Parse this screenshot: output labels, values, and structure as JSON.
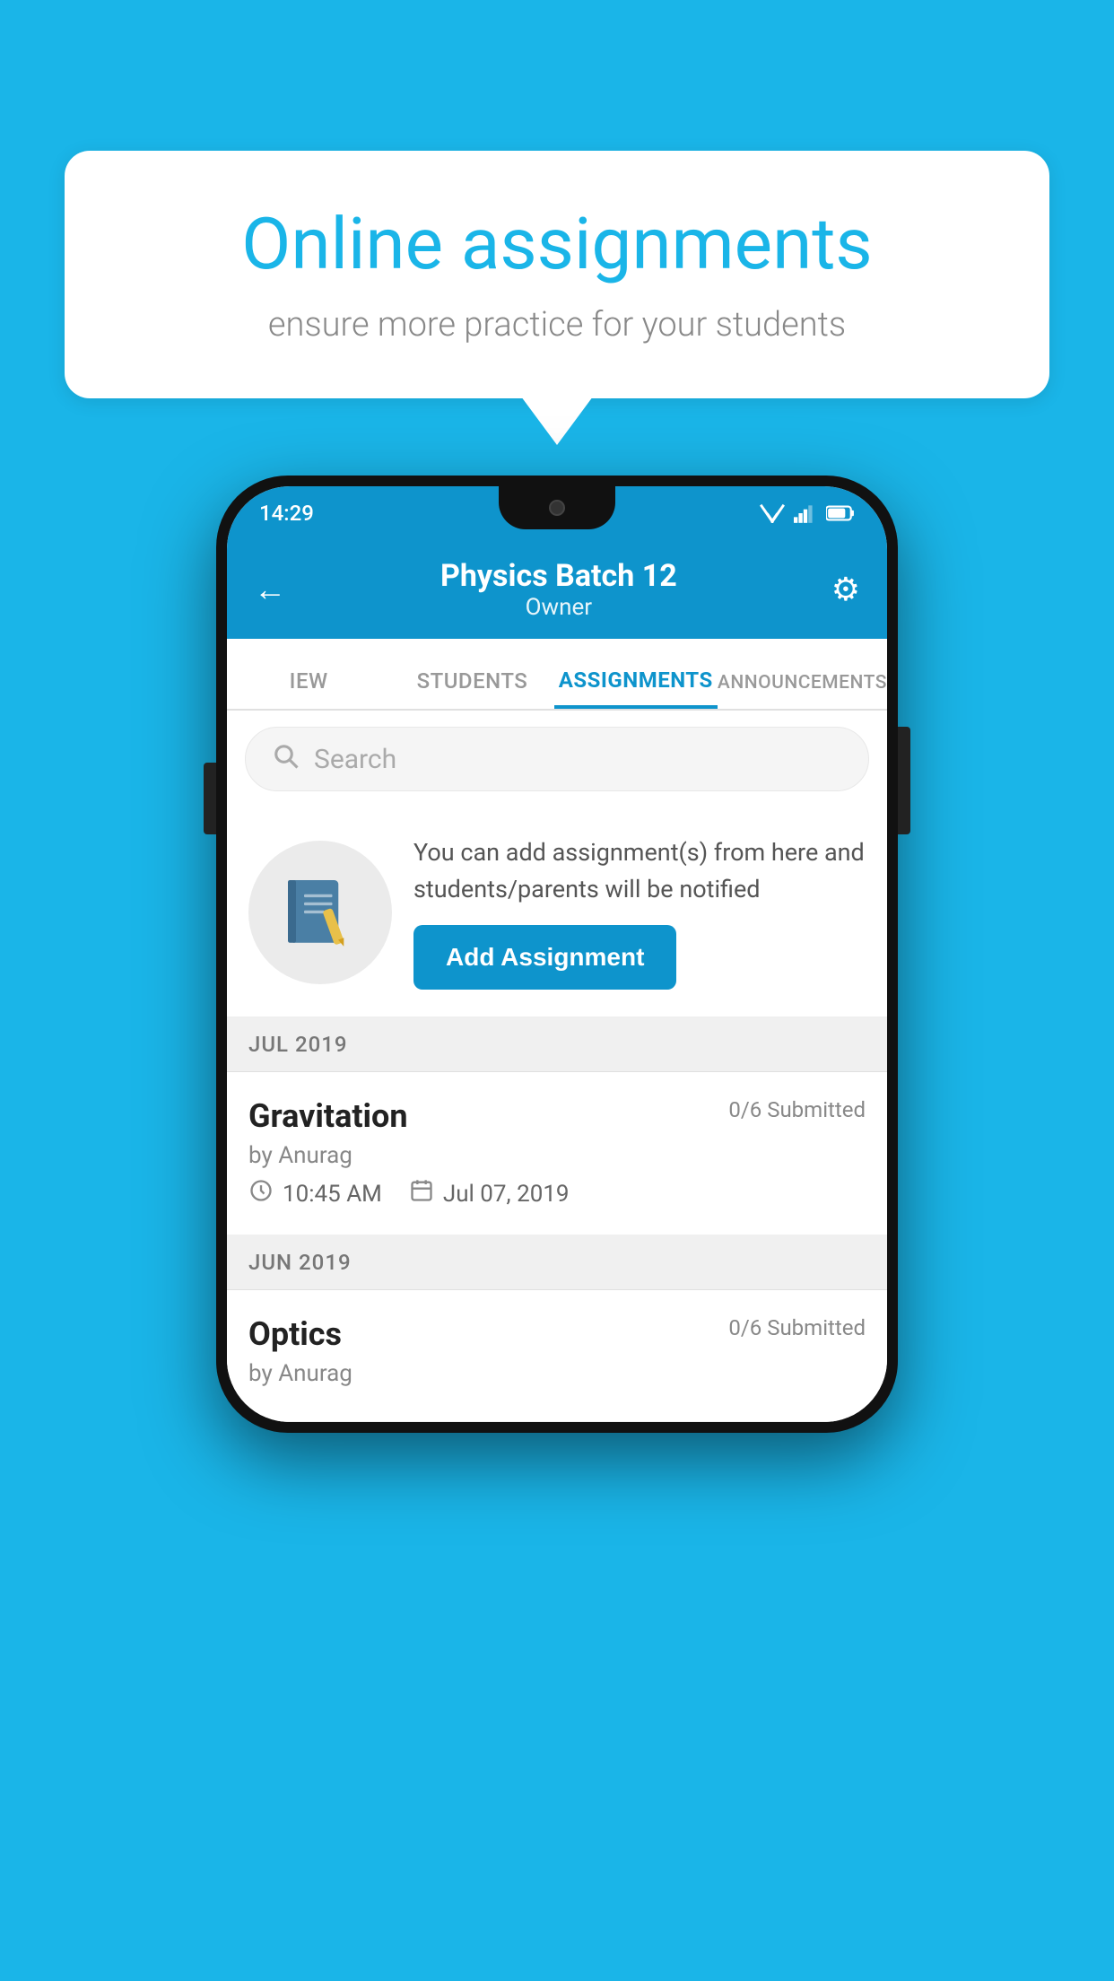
{
  "background": {
    "color": "#1ab5e8"
  },
  "speech_bubble": {
    "title": "Online assignments",
    "subtitle": "ensure more practice for your students"
  },
  "status_bar": {
    "time": "14:29",
    "wifi_icon": "wifi-icon",
    "signal_icon": "signal-icon",
    "battery_icon": "battery-icon"
  },
  "app_bar": {
    "back_label": "←",
    "batch_name": "Physics Batch 12",
    "owner_label": "Owner",
    "settings_icon": "⚙"
  },
  "tabs": [
    {
      "id": "iew",
      "label": "IEW",
      "active": false
    },
    {
      "id": "students",
      "label": "STUDENTS",
      "active": false
    },
    {
      "id": "assignments",
      "label": "ASSIGNMENTS",
      "active": true
    },
    {
      "id": "announcements",
      "label": "ANNOUNCEMENTS",
      "active": false
    }
  ],
  "search": {
    "placeholder": "Search"
  },
  "promo": {
    "text": "You can add assignment(s) from here and students/parents will be notified",
    "button_label": "Add Assignment"
  },
  "sections": [
    {
      "header": "JUL 2019",
      "assignments": [
        {
          "name": "Gravitation",
          "submitted": "0/6 Submitted",
          "by": "by Anurag",
          "time": "10:45 AM",
          "date": "Jul 07, 2019"
        }
      ]
    },
    {
      "header": "JUN 2019",
      "assignments": [
        {
          "name": "Optics",
          "submitted": "0/6 Submitted",
          "by": "by Anurag",
          "time": "",
          "date": ""
        }
      ]
    }
  ]
}
